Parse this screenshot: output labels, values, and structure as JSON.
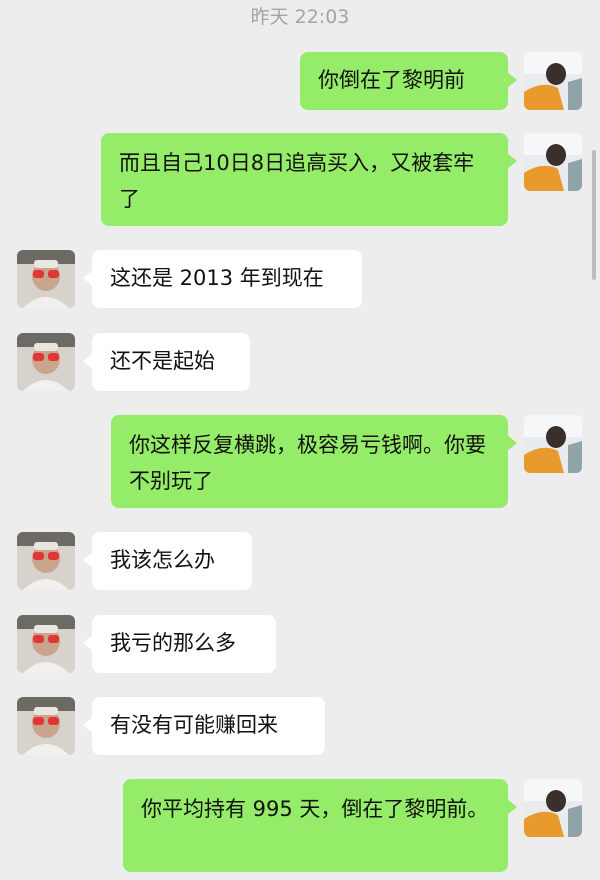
{
  "timestamp": "昨天 22:03",
  "messages": [
    {
      "side": "me",
      "text": "你倒在了黎明前"
    },
    {
      "side": "me",
      "text": "而且自己10日8日追高买入，又被套牢了"
    },
    {
      "side": "them",
      "text": "这还是 2013 年到现在"
    },
    {
      "side": "them",
      "text": "还不是起始"
    },
    {
      "side": "me",
      "text": "你这样反复横跳，极容易亏钱啊。你要不别玩了"
    },
    {
      "side": "them",
      "text": "我该怎么办"
    },
    {
      "side": "them",
      "text": "我亏的那么多"
    },
    {
      "side": "them",
      "text": "有没有可能赚回来"
    },
    {
      "side": "me",
      "text": "你平均持有 995 天，倒在了黎明前。"
    }
  ],
  "colors": {
    "background": "#ededed",
    "me_bubble": "#95ec69",
    "them_bubble": "#ffffff",
    "timestamp_text": "#a3a3a3"
  },
  "icons": {
    "me_avatar": "user-avatar-orange-shirt",
    "them_avatar": "contact-avatar-red-glasses"
  }
}
